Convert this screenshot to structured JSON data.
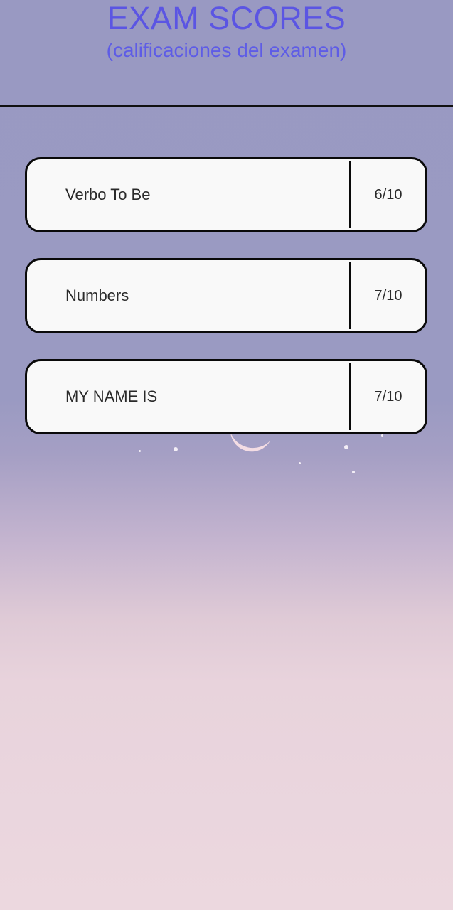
{
  "header": {
    "title": "EXAM SCORES",
    "subtitle": "(calificaciones del examen)"
  },
  "scores": [
    {
      "name": "Verbo To Be",
      "score": "6/10"
    },
    {
      "name": "Numbers",
      "score": "7/10"
    },
    {
      "name": "MY NAME IS",
      "score": "7/10"
    }
  ],
  "colors": {
    "title": "#5b55e3",
    "card_background": "#f9f9f9",
    "card_border": "#0a0a0a",
    "sky_top": "#9999c2",
    "sky_bottom": "#ecd8df"
  },
  "icons": {
    "moon": "crescent-moon-icon",
    "stars": "star-icon"
  }
}
